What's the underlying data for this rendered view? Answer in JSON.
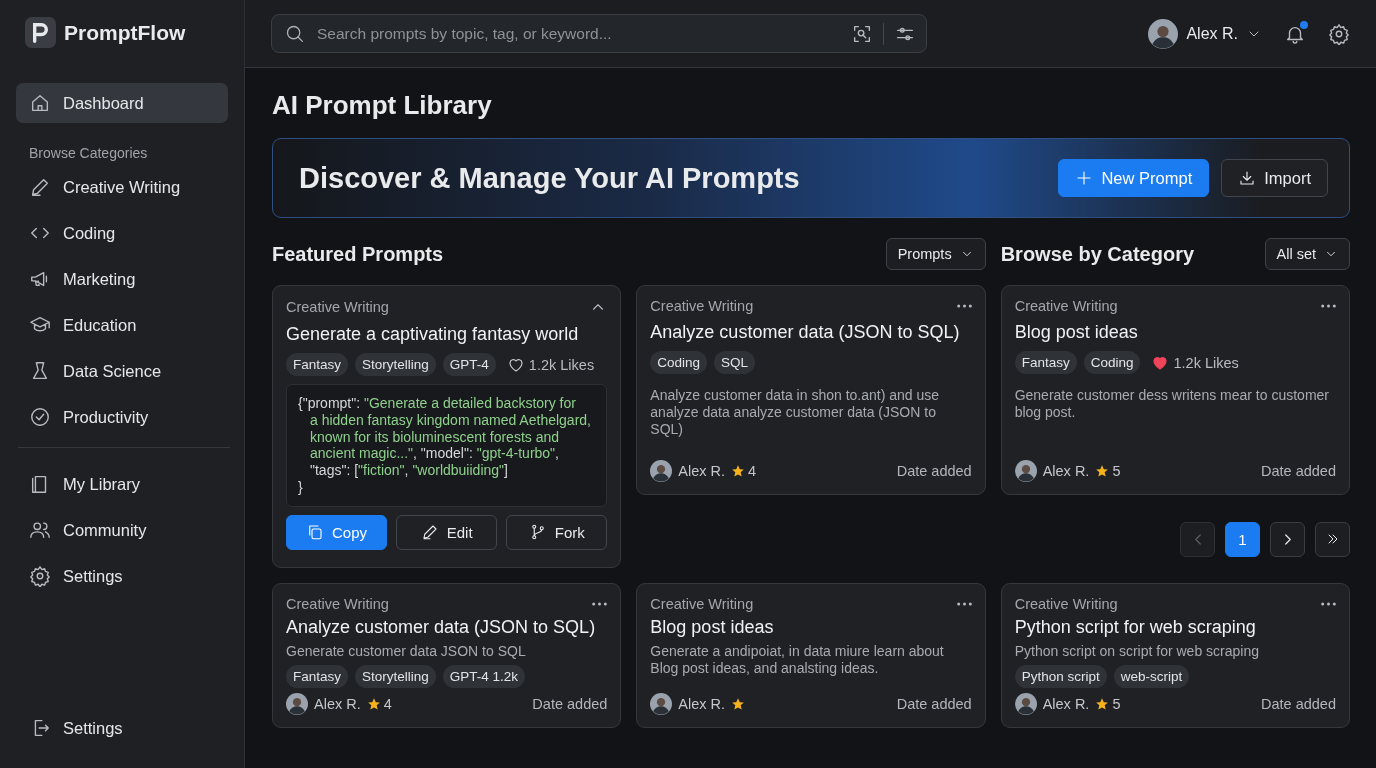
{
  "app": {
    "name": "PromptFlow"
  },
  "sidebar": {
    "items": [
      {
        "label": "Dashboard",
        "selected": true
      }
    ],
    "section_label": "Browse Categories",
    "categories": [
      {
        "label": "Creative Writing",
        "selected": false
      },
      {
        "label": "Coding",
        "selected": false
      },
      {
        "label": "Marketing",
        "selected": false
      },
      {
        "label": "Education",
        "selected": false
      },
      {
        "label": "Data Science",
        "selected": false
      },
      {
        "label": "Productivity",
        "selected": false
      }
    ],
    "library": [
      {
        "label": "My Library",
        "selected": false
      },
      {
        "label": "Community",
        "selected": false
      },
      {
        "label": "Settings",
        "selected": false
      }
    ],
    "footer": {
      "label": "Settings"
    }
  },
  "topbar": {
    "search": {
      "placeholder": "Search prompts by topic, tag, or keyword..."
    },
    "user": "Alex R.",
    "notification": true
  },
  "page_title": "AI Prompt Library",
  "banner": {
    "title": "Discover & Manage Your AI Prompts",
    "buttons": [
      {
        "label": "New Prompt",
        "primary": true
      },
      {
        "label": "Import",
        "primary": false
      }
    ]
  },
  "featured": {
    "title": "Featured Prompts",
    "filter": "Prompts"
  },
  "browse": {
    "title": "Browse by Category",
    "filter": "All set"
  },
  "cards": [
    {
      "kind": "featured",
      "category": "Creative Writing",
      "title": "Generate a captivating fantasy world",
      "tags": [
        "Fantasy",
        "Storytelling",
        "GPT-4"
      ],
      "likes": {
        "text": "1.2k Likes",
        "liked": false
      },
      "code": [
        [
          {
            "text": "{\"prompt\": ",
            "kind": "plain"
          },
          {
            "text": "\"Generate a detailed backstory for",
            "kind": "string"
          }
        ],
        [
          {
            "text": "a hidden fantasy kingdom named Aethelgard,",
            "kind": "string"
          }
        ],
        [
          {
            "text": "known for its bioluminescent forests and",
            "kind": "string"
          }
        ],
        [
          {
            "text": "ancient magic...\"",
            "kind": "string"
          },
          {
            "text": ", \"model\": ",
            "kind": "plain"
          },
          {
            "text": "\"gpt-4-turbo\"",
            "kind": "string"
          },
          {
            "text": ",",
            "kind": "plain"
          }
        ],
        [
          {
            "text": "\"tags\": [",
            "kind": "plain"
          },
          {
            "text": "\"fiction\"",
            "kind": "string"
          },
          {
            "text": ", ",
            "kind": "plain"
          },
          {
            "text": "\"worldbuiiding\"",
            "kind": "string"
          },
          {
            "text": "]",
            "kind": "plain"
          }
        ],
        [
          {
            "text": "}",
            "kind": "plain"
          }
        ]
      ],
      "buttons": [
        {
          "label": "Copy",
          "primary": true
        },
        {
          "label": "Edit",
          "primary": false
        },
        {
          "label": "Fork",
          "primary": false
        }
      ]
    },
    {
      "kind": "standard",
      "category": "Creative Writing",
      "title": "Analyze customer data (JSON to SQL)",
      "tags": [
        "Coding",
        "SQL"
      ],
      "description": "Analyze  customer data in shon to.ant) and use analyze data analyze customer data (JSON to SQL)",
      "author": "Alex R.",
      "rating": "4",
      "date": "Date added"
    },
    {
      "kind": "standard",
      "category": "Creative Writing",
      "title": "Blog post ideas",
      "tags": [
        "Fantasy",
        "Coding"
      ],
      "likes": {
        "text": "1.2k Likes",
        "liked": true
      },
      "description": "Generate customer dess writens mear to customer blog post.",
      "author": "Alex R.",
      "rating": "5",
      "date": "Date added"
    },
    {
      "kind": "compact",
      "category": "Creative Writing",
      "title": "Analyze customer data (JSON to SQL)",
      "description": "Generate customer data JSON to SQL",
      "tags": [
        "Fantasy",
        "Storytelling",
        "GPT-4 1.2k"
      ],
      "author": "Alex R.",
      "rating": "4",
      "date": "Date added"
    },
    {
      "kind": "compact",
      "category": "Creative Writing",
      "title": "Blog post ideas",
      "description": "Generate a andipoiat, in data miure learn about Blog post ideas, and analsting ideas.",
      "author": "Alex R.",
      "date": "Date added"
    },
    {
      "kind": "compact",
      "category": "Creative Writing",
      "title": "Python script for web scraping",
      "description": "Python script on script for web scraping",
      "tags": [
        "Python script",
        "web-script"
      ],
      "author": "Alex R.",
      "rating": "5",
      "date": "Date added"
    }
  ],
  "pagination": {
    "prev_disabled": true,
    "pages": [
      {
        "label": "1",
        "selected": true
      }
    ]
  }
}
